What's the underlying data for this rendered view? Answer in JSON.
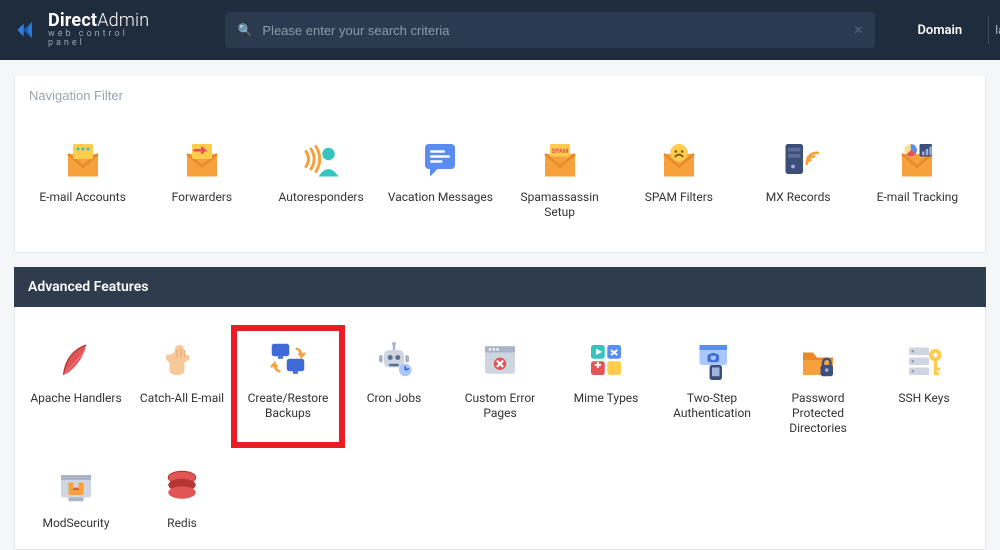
{
  "header": {
    "brand_main": "Direct",
    "brand_thin": "Admin",
    "brand_sub": "web control panel",
    "search_placeholder": "Please enter your search criteria",
    "domain_button": "Domain",
    "user_crumb": "la"
  },
  "nav_filter_placeholder": "Navigation Filter",
  "email_section_items": [
    {
      "id": "email-accounts",
      "label": "E-mail Accounts",
      "icon": "envelope"
    },
    {
      "id": "forwarders",
      "label": "Forwarders",
      "icon": "envelope-arrow"
    },
    {
      "id": "autoresponders",
      "label": "Autoresponders",
      "icon": "waves-user"
    },
    {
      "id": "vacation-messages",
      "label": "Vacation Messages",
      "icon": "chat-note"
    },
    {
      "id": "spamassassin-setup",
      "label": "Spamassassin Setup",
      "icon": "envelope-spam"
    },
    {
      "id": "spam-filters",
      "label": "SPAM Filters",
      "icon": "envelope-face"
    },
    {
      "id": "mx-records",
      "label": "MX Records",
      "icon": "server-wifi"
    },
    {
      "id": "email-tracking",
      "label": "E-mail Tracking",
      "icon": "envelope-chart"
    }
  ],
  "advanced": {
    "title": "Advanced Features",
    "items_row1": [
      {
        "id": "apache-handlers",
        "label": "Apache Handlers",
        "icon": "feather"
      },
      {
        "id": "catch-all-email",
        "label": "Catch-All E-mail",
        "icon": "glove"
      },
      {
        "id": "create-restore-backups",
        "label": "Create/Restore Backups",
        "icon": "monitors-sync",
        "highlight": true
      },
      {
        "id": "cron-jobs",
        "label": "Cron Jobs",
        "icon": "robot"
      },
      {
        "id": "custom-error-pages",
        "label": "Custom Error Pages",
        "icon": "browser-x"
      },
      {
        "id": "mime-types",
        "label": "Mime Types",
        "icon": "media-grid"
      },
      {
        "id": "two-step-auth",
        "label": "Two-Step Authentication",
        "icon": "twofa"
      },
      {
        "id": "password-protected-dirs",
        "label": "Password Protected Directories",
        "icon": "folder-lock"
      },
      {
        "id": "ssh-keys",
        "label": "SSH Keys",
        "icon": "server-key"
      }
    ],
    "items_row2": [
      {
        "id": "modsecurity",
        "label": "ModSecurity",
        "icon": "modsec"
      },
      {
        "id": "redis",
        "label": "Redis",
        "icon": "redis"
      }
    ]
  }
}
